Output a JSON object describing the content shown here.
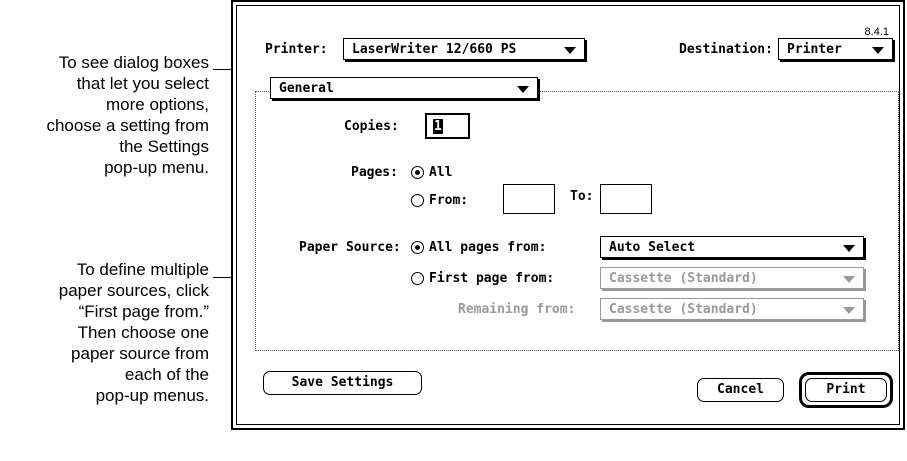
{
  "annotations": {
    "settings_note": [
      "To see dialog boxes",
      "that let you select",
      "more options,",
      "choose a setting from",
      "the Settings",
      "pop-up menu."
    ],
    "paper_note": [
      "To define multiple",
      "paper sources, click",
      "“First page from.”",
      "Then choose one",
      "paper source from",
      "each of the",
      "pop-up menus."
    ]
  },
  "dialog": {
    "version": "8.4.1",
    "printer_label": "Printer:",
    "printer_value": "LaserWriter 12/660 PS",
    "destination_label": "Destination:",
    "destination_value": "Printer",
    "settings_value": "General",
    "copies_label": "Copies:",
    "copies_value": "1",
    "pages_label": "Pages:",
    "pages_all": "All",
    "pages_from": "From:",
    "pages_to": "To:",
    "pages_from_value": "",
    "pages_to_value": "",
    "paper_source_label": "Paper Source:",
    "all_pages_from": "All pages from:",
    "all_pages_value": "Auto Select",
    "first_page_from": "First page from:",
    "first_page_value": "Cassette (Standard)",
    "remaining_from": "Remaining from:",
    "remaining_value": "Cassette (Standard)",
    "save_settings": "Save Settings",
    "cancel": "Cancel",
    "print": "Print"
  }
}
